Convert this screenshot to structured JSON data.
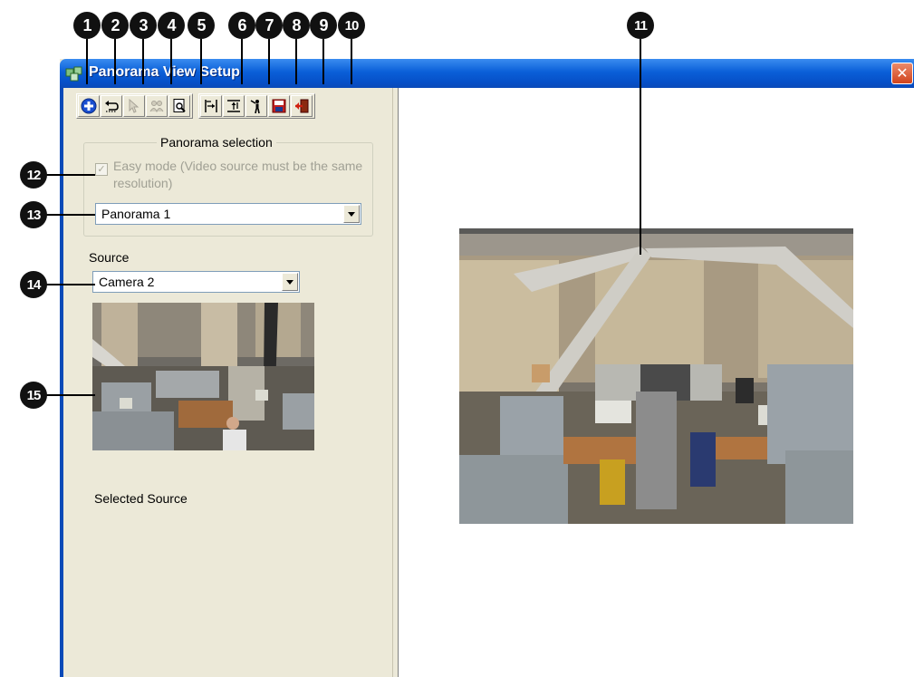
{
  "callouts": [
    "1",
    "2",
    "3",
    "4",
    "5",
    "6",
    "7",
    "8",
    "9",
    "10",
    "11",
    "12",
    "13",
    "14",
    "15"
  ],
  "window": {
    "title": "Panorama View Setup",
    "close_glyph": "✕"
  },
  "toolbar": {
    "buttons": [
      {
        "name": "add-icon"
      },
      {
        "name": "undo-icon"
      },
      {
        "name": "pointer-icon"
      },
      {
        "name": "group-icon"
      },
      {
        "name": "preview-icon"
      },
      {
        "name": "align-horizontal-icon"
      },
      {
        "name": "align-vertical-icon"
      },
      {
        "name": "person-icon"
      },
      {
        "name": "save-icon"
      },
      {
        "name": "exit-icon"
      }
    ]
  },
  "panorama_selection": {
    "legend": "Panorama selection",
    "easy_mode_label": "Easy mode (Video source must be the same resolution)",
    "easy_mode_checked": true,
    "panorama_value": "Panorama 1"
  },
  "source": {
    "label": "Source",
    "value": "Camera 2",
    "selected_label": "Selected Source"
  },
  "colors": {
    "titlebar": "#0a5fd8",
    "window_bg": "#ece9d8",
    "callout": "#111111"
  }
}
